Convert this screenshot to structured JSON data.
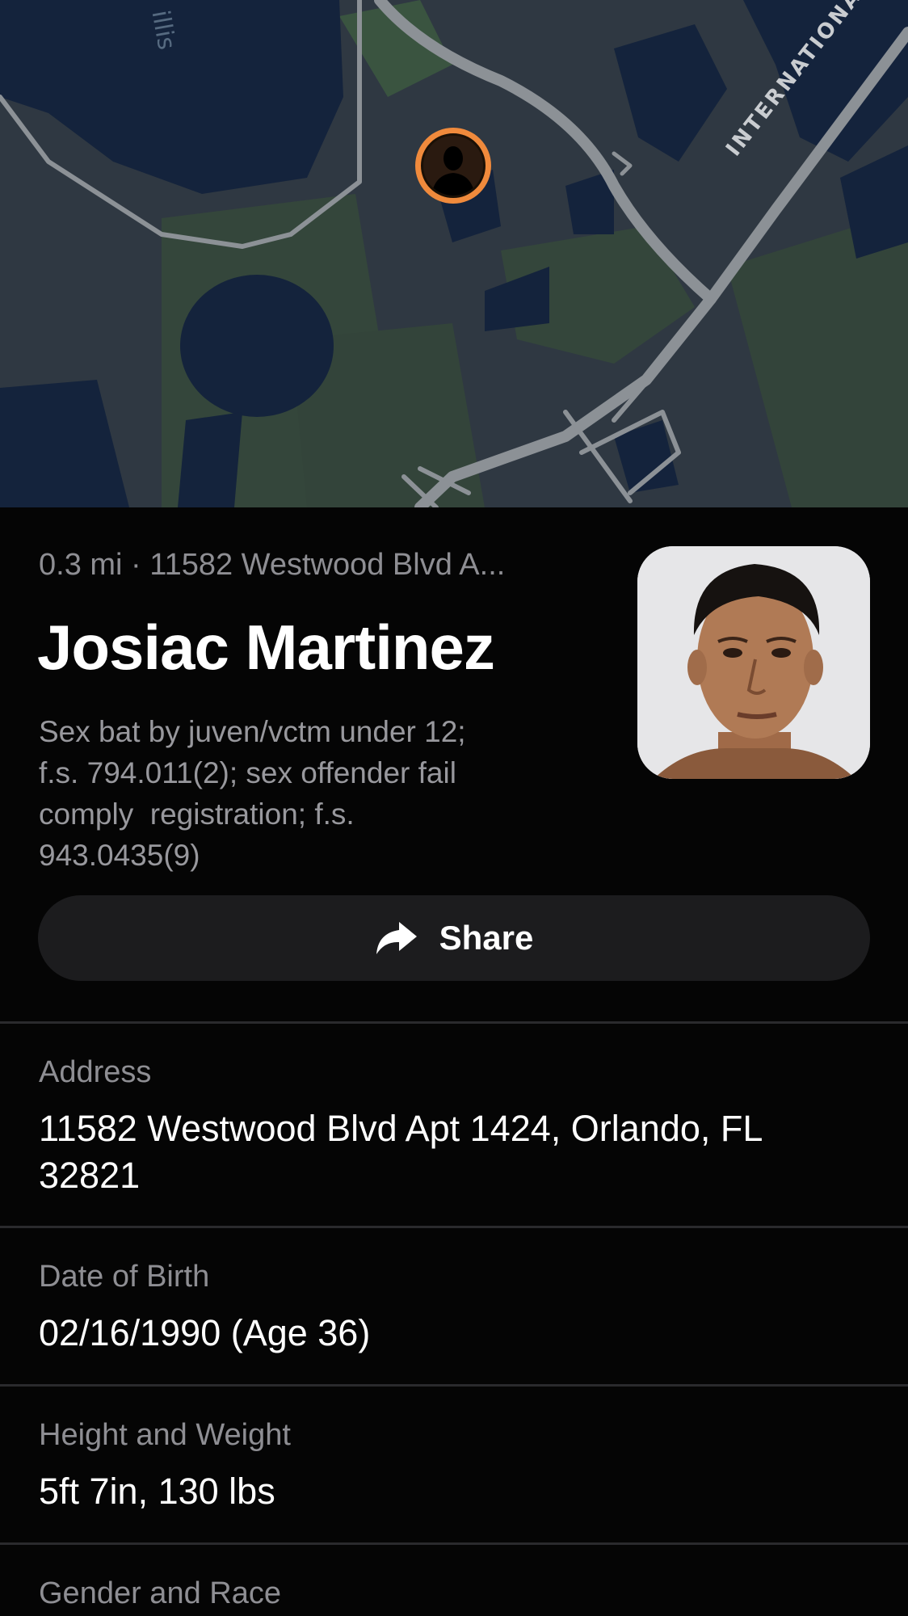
{
  "map": {
    "road_label": "INTERNATIONAL",
    "area_label": "illis",
    "pin_icon": "person-avatar-pin"
  },
  "profile": {
    "subtitle": "0.3 mi · 11582 Westwood Blvd A...",
    "name": "Josiac Martinez",
    "offense": "Sex bat by juven/vctm under 12;\nf.s. 794.011(2); sex offender fail\ncomply  registration; f.s.\n943.0435(9)",
    "photo": "mugshot-photo"
  },
  "share": {
    "label": "Share",
    "icon": "share-arrow-icon"
  },
  "details": [
    {
      "label": "Address",
      "value": "11582 Westwood Blvd Apt 1424, Orlando, FL 32821"
    },
    {
      "label": "Date of Birth",
      "value": "02/16/1990 (Age 36)"
    },
    {
      "label": "Height and Weight",
      "value": "5ft 7in, 130 lbs"
    },
    {
      "label": "Gender and Race",
      "value": ""
    }
  ],
  "colors": {
    "background": "#050505",
    "map_land": "#2f3842",
    "map_water": "#13213a",
    "map_park": "#3a4a3e",
    "map_road": "#8c9196",
    "pin_accent": "#f08a3c",
    "secondary_text": "#8e8e93",
    "button_bg": "#1c1c1e"
  }
}
